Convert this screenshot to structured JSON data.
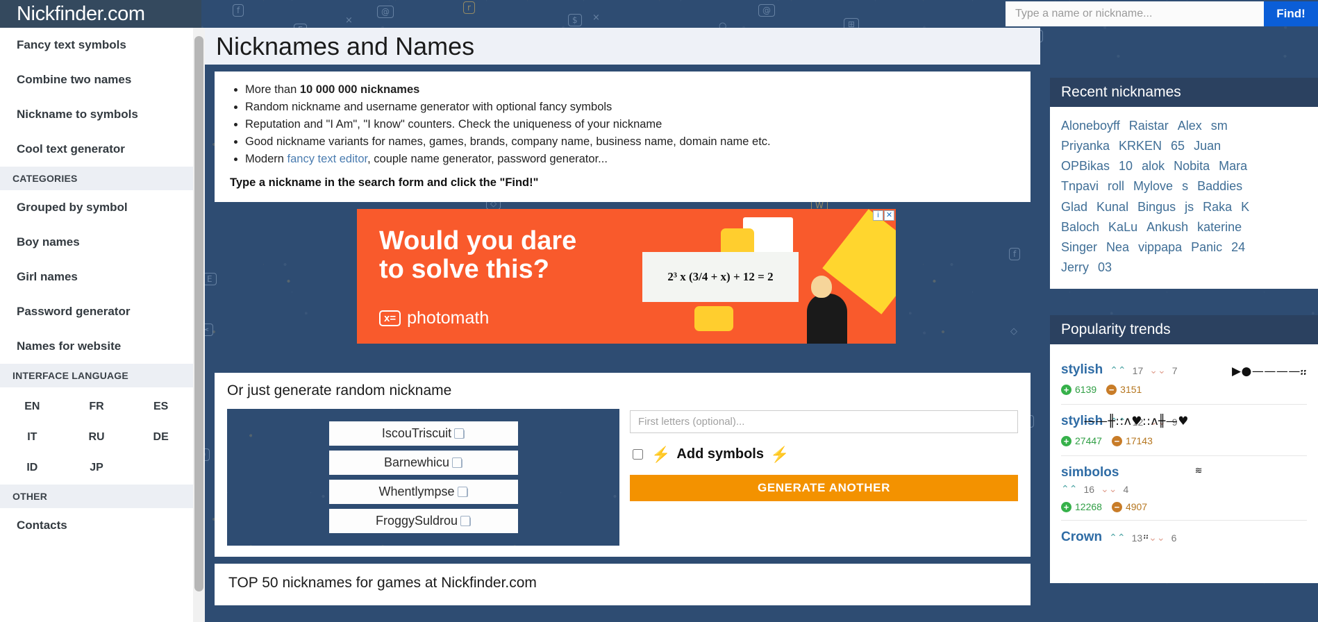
{
  "brand": {
    "title": "Nickfinder.com"
  },
  "search": {
    "placeholder": "Type a name or nickname...",
    "value": "",
    "find_label": "Find!"
  },
  "sidebar": {
    "top_links": [
      {
        "label": "Fancy text symbols"
      },
      {
        "label": "Combine two names"
      },
      {
        "label": "Nickname to symbols"
      },
      {
        "label": "Cool text generator"
      }
    ],
    "categories_heading": "CATEGORIES",
    "category_links": [
      {
        "label": "Grouped by symbol"
      },
      {
        "label": "Boy names"
      },
      {
        "label": "Girl names"
      },
      {
        "label": "Password generator"
      },
      {
        "label": "Names for website"
      }
    ],
    "language_heading": "INTERFACE LANGUAGE",
    "languages": [
      "EN",
      "FR",
      "ES",
      "IT",
      "RU",
      "DE",
      "ID",
      "JP"
    ],
    "other_heading": "OTHER",
    "other_links": [
      {
        "label": "Contacts"
      }
    ]
  },
  "main": {
    "page_title": "Nicknames and Names",
    "intro": {
      "bullets": [
        {
          "pre": "More than ",
          "bold": "10 000 000 nicknames",
          "post": ""
        },
        {
          "pre": "Random nickname and username generator with optional fancy symbols",
          "bold": "",
          "post": ""
        },
        {
          "pre": "Reputation and \"I Am\", \"I know\" counters. Check the uniqueness of your nickname",
          "bold": "",
          "post": ""
        },
        {
          "pre": "Good nickname variants for names, games, brands, company name, business name, domain name etc.",
          "bold": "",
          "post": ""
        },
        {
          "pre": "Modern ",
          "link": "fancy text editor",
          "post": ", couple name generator, password generator..."
        }
      ],
      "cta": "Type a nickname in the search form and click the \"Find!\""
    },
    "ad": {
      "headline_line1": "Would you dare",
      "headline_line2": "to solve this?",
      "brand": "photomath",
      "brand_mark": "x=",
      "equation": "2³ x (3/4 + x) + 12 = 2",
      "info_icon": "i",
      "close_icon": "✕"
    },
    "generator": {
      "title": "Or just generate random nickname",
      "nicknames": [
        "IscouTriscuit",
        "Barnewhicu",
        "Whentlympse",
        "FroggySuldrou"
      ],
      "first_letters_placeholder": "First letters (optional)...",
      "first_letters_value": "",
      "add_symbols_label": "Add symbols",
      "add_symbols_checked": false,
      "generate_label": "GENERATE ANOTHER"
    },
    "bottom_section_title": "TOP 50 nicknames for games at Nickfinder.com"
  },
  "rail": {
    "recent": {
      "heading": "Recent nicknames",
      "rows": [
        [
          "Aloneboyff",
          "Raistar",
          "Alex",
          "sm"
        ],
        [
          "Priyanka",
          "KRKEN",
          "65",
          "Juan"
        ],
        [
          "OPBikas",
          "10",
          "alok",
          "Nobita",
          "Mara"
        ],
        [
          "Tnpavi",
          "roll",
          "Mylove",
          "s",
          "Baddies"
        ],
        [
          "Glad",
          "Kunal",
          "Bingus",
          "js",
          "Raka",
          "K"
        ],
        [
          "Baloch",
          "KaLu",
          "Ankush",
          "katerine"
        ],
        [
          "Singer",
          "Nea",
          "vippapa",
          "Panic",
          "24"
        ],
        [
          "Jerry",
          "03"
        ]
      ]
    },
    "trends": {
      "heading": "Popularity trends",
      "items": [
        {
          "name": "stylish",
          "up": "17",
          "down": "7",
          "plus": "6139",
          "minus": "3151",
          "art": "▶●————᎓᎓",
          "art_class": ""
        },
        {
          "name": "stylish",
          "up": "12",
          "down": "9",
          "plus": "27447",
          "minus": "17143",
          "art": "——╫꞉꞉ʌ♥꞉꞉ʌ╫—♥",
          "art_class": "mid"
        },
        {
          "name": "simbolos",
          "up": "16",
          "down": "4",
          "plus": "12268",
          "minus": "4907",
          "art": "≋",
          "art_class": "tiny"
        },
        {
          "name": "Crown",
          "up": "13",
          "down": "6",
          "plus": "",
          "minus": "",
          "art": "᎓᎓",
          "art_class": "tiny"
        }
      ]
    }
  },
  "colors": {
    "brand_bar": "#34495e",
    "accent_blue": "#0b5ed7",
    "accent_orange": "#f39200",
    "background_navy": "#2e4c72",
    "panel_head": "#2b4160",
    "link_blue": "#3f6e96",
    "plus_green": "#36b14a",
    "minus_brown": "#c87c28",
    "ad_orange": "#f95a2c"
  }
}
